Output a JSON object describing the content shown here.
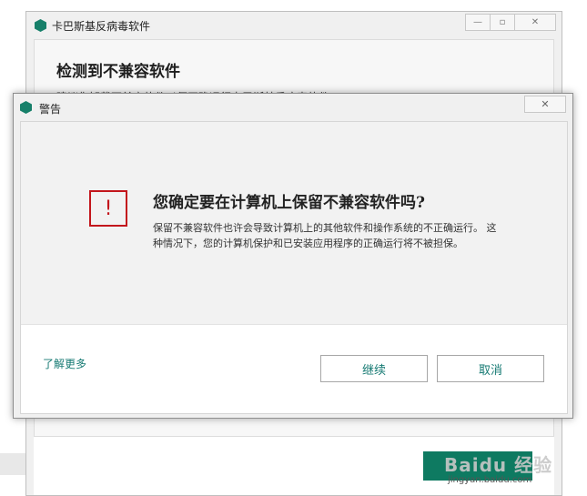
{
  "background_window": {
    "title": "卡巴斯基反病毒软件",
    "heading": "检测到不兼容软件",
    "subtitle": "建议您卸载不兼容软件以便正确运行卡巴斯基反病毒软件"
  },
  "dialog": {
    "title": "警告",
    "question": "您确定要在计算机上保留不兼容软件吗?",
    "explanation": "保留不兼容软件也许会导致计算机上的其他软件和操作系统的不正确运行。 这种情况下，您的计算机保护和已安装应用程序的正确运行将不被担保。",
    "learn_more": "了解更多",
    "continue_label": "继续",
    "cancel_label": "取消",
    "warning_glyph": "!"
  },
  "watermark": {
    "text": "Baidu 经验",
    "url": "jingyan.baidu.com"
  },
  "colors": {
    "accent": "#167a73",
    "warning": "#c3161c",
    "brand_green": "#0e7a61"
  },
  "icons": [
    "kaspersky-logo-icon",
    "minimize-icon",
    "maximize-icon",
    "close-icon",
    "warning-icon"
  ]
}
